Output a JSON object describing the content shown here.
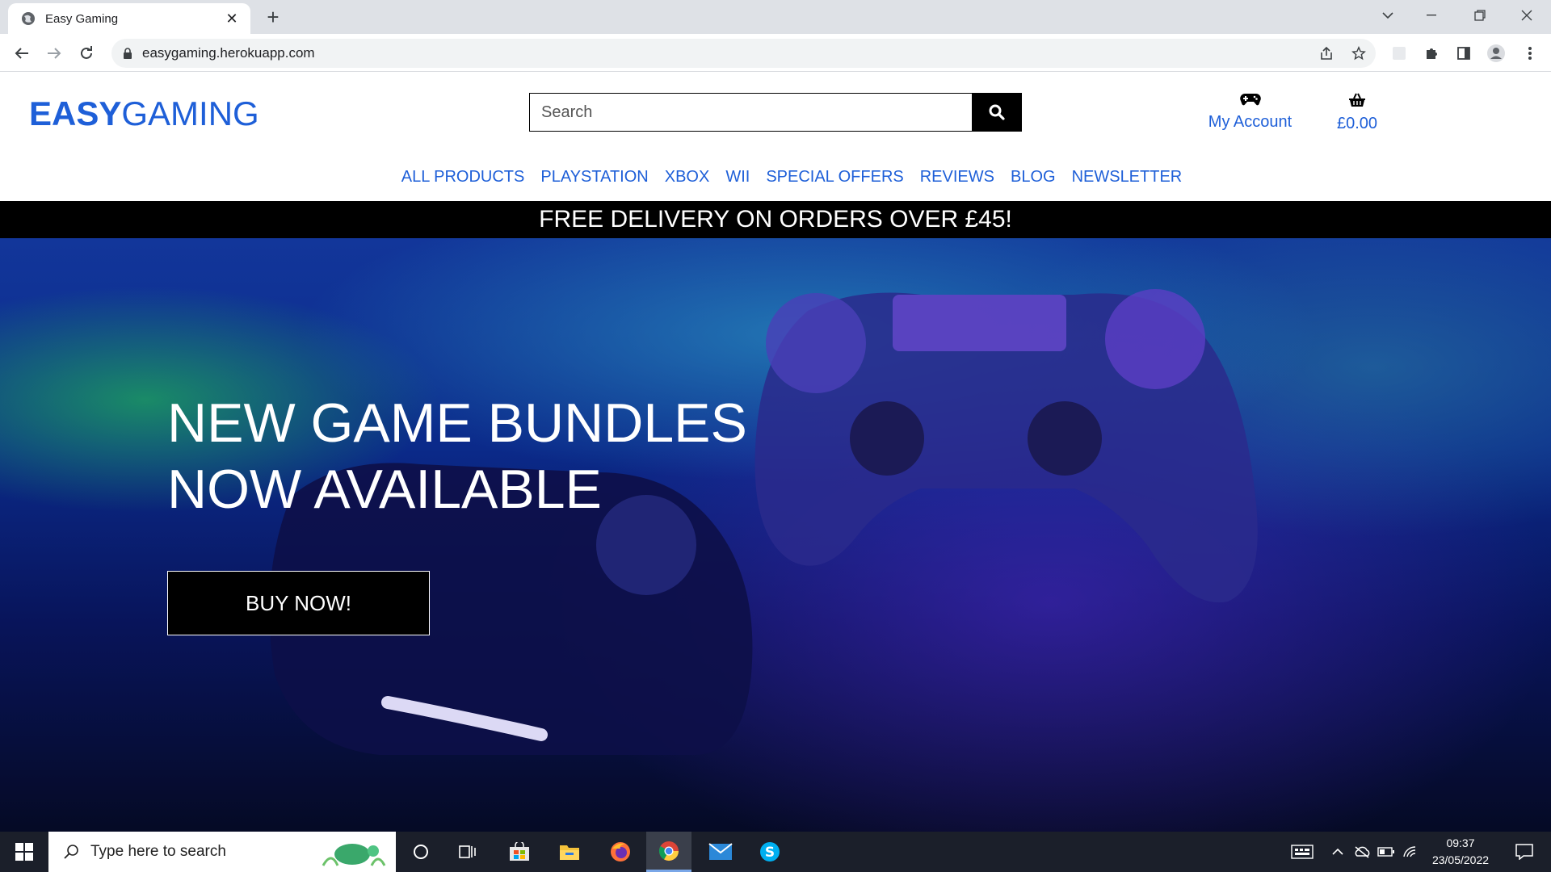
{
  "browser": {
    "tab_title": "Easy Gaming",
    "url": "easygaming.herokuapp.com"
  },
  "site": {
    "logo_bold": "EASY",
    "logo_light": "GAMING",
    "search_placeholder": "Search",
    "account_label": "My Account",
    "basket_total": "£0.00",
    "nav": [
      "ALL PRODUCTS",
      "PLAYSTATION",
      "XBOX",
      "WII",
      "SPECIAL OFFERS",
      "REVIEWS",
      "BLOG",
      "NEWSLETTER"
    ],
    "delivery_banner": "FREE DELIVERY ON ORDERS OVER £45!"
  },
  "hero": {
    "title_line1": "NEW GAME BUNDLES",
    "title_line2": "NOW AVAILABLE",
    "cta": "BUY NOW!"
  },
  "taskbar": {
    "search_placeholder": "Type here to search",
    "time": "09:37",
    "date": "23/05/2022",
    "apps": [
      "cortana-icon",
      "task-view-icon",
      "store-icon",
      "file-explorer-icon",
      "firefox-icon",
      "chrome-icon",
      "mail-icon",
      "skype-icon"
    ]
  },
  "colors": {
    "brand_blue": "#1e5fd8",
    "banner_black": "#000000"
  }
}
